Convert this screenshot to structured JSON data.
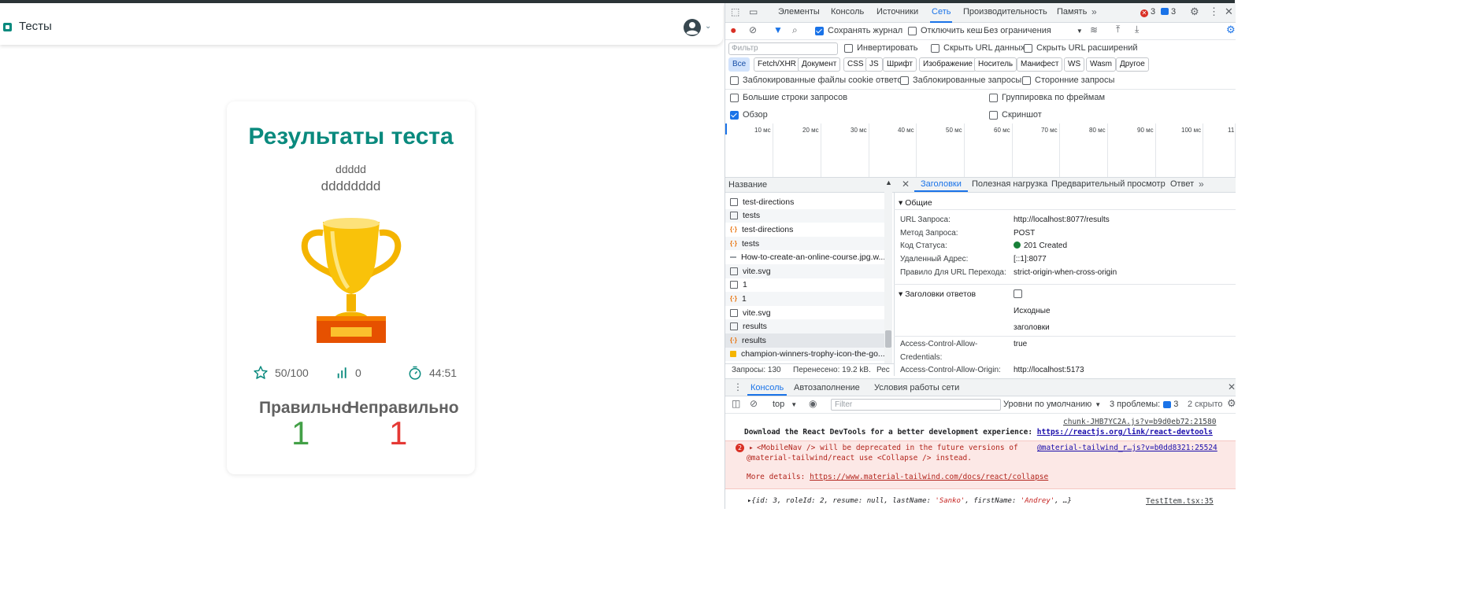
{
  "app": {
    "title": "Тесты",
    "card": {
      "title": "Результаты теста",
      "subtitle1": "ddddd",
      "subtitle2": "dddddddd",
      "stats": {
        "score": "50/100",
        "count": "0",
        "time": "44:51"
      },
      "labels": {
        "correct": "Правильно",
        "incorrect": "Неправильно"
      },
      "values": {
        "correct": "1",
        "incorrect": "1"
      }
    }
  },
  "devtools": {
    "tabs": [
      "Элементы",
      "Консоль",
      "Источники",
      "Сеть",
      "Производительность",
      "Память"
    ],
    "errors": "3",
    "messages": "3",
    "toolbar": {
      "preserve_log": "Сохранять журнал",
      "disable_cache": "Отключить кеш",
      "throttling": "Без ограничения"
    },
    "filter_placeholder": "Фильтр",
    "filter_options": {
      "invert": "Инвертировать",
      "hide_data": "Скрыть URL данных",
      "hide_ext": "Скрыть URL расширений"
    },
    "chips": [
      "Все",
      "Fetch/XHR",
      "Документ",
      "CSS",
      "JS",
      "Шрифт",
      "Изображение",
      "Носитель",
      "Манифест",
      "WS",
      "Wasm",
      "Другое"
    ],
    "checks": {
      "blocked_cookies": "Заблокированные файлы cookie ответов",
      "blocked_requests": "Заблокированные запросы",
      "third_party": "Сторонние запросы",
      "big_rows": "Большие строки запросов",
      "group_frames": "Группировка по фреймам",
      "overview": "Обзор",
      "screenshot": "Скриншот"
    },
    "timeline_ticks": [
      "10 мс",
      "20 мс",
      "30 мс",
      "40 мс",
      "50 мс",
      "60 мс",
      "70 мс",
      "80 мс",
      "90 мс",
      "100 мс",
      "11"
    ],
    "list_header": "Название",
    "requests": [
      {
        "name": "test-directions",
        "type": "doc"
      },
      {
        "name": "tests",
        "type": "doc"
      },
      {
        "name": "test-directions",
        "type": "xhr"
      },
      {
        "name": "tests",
        "type": "xhr"
      },
      {
        "name": "How-to-create-an-online-course.jpg.w...",
        "type": "img"
      },
      {
        "name": "vite.svg",
        "type": "doc"
      },
      {
        "name": "1",
        "type": "doc"
      },
      {
        "name": "1",
        "type": "xhr"
      },
      {
        "name": "vite.svg",
        "type": "doc"
      },
      {
        "name": "results",
        "type": "doc"
      },
      {
        "name": "results",
        "type": "xhr"
      },
      {
        "name": "champion-winners-trophy-icon-the-go...",
        "type": "trophy"
      }
    ],
    "footer": {
      "requests": "Запросы: 130",
      "transferred": "Перенесено: 19.2 kB.",
      "resources": "Рес"
    },
    "detail_tabs": [
      "Заголовки",
      "Полезная нагрузка",
      "Предварительный просмотр",
      "Ответ"
    ],
    "general_title": "Общие",
    "general": [
      {
        "k": "URL Запроса:",
        "v": "http://localhost:8077/results"
      },
      {
        "k": "Метод Запроса:",
        "v": "POST"
      },
      {
        "k": "Код Статуса:",
        "v": "201 Created"
      },
      {
        "k": "Удаленный Адрес:",
        "v": "[::1]:8077"
      },
      {
        "k": "Правило Для URL Перехода:",
        "v": "strict-origin-when-cross-origin"
      }
    ],
    "resp_title": "Заголовки ответов",
    "raw_1": "Исходные",
    "raw_2": "заголовки",
    "acac_k1": "Access-Control-Allow-",
    "acac_k2": "Credentials:",
    "acac_v": "true",
    "acao_k": "Access-Control-Allow-Origin:",
    "acao_v": "http://localhost:5173",
    "drawer_tabs": [
      "Консоль",
      "Автозаполнение",
      "Условия работы сети"
    ],
    "console_bar": {
      "context": "top",
      "filter": "Filter",
      "levels": "Уровни по умолчанию",
      "problems": "3 проблемы:",
      "problems_count": "3",
      "hidden": "2 скрыто"
    },
    "console": {
      "src1": "chunk-JHB7YC2A.js?v=b9d0eb72:21580",
      "msg1": "Download the React DevTools for a better development experience:",
      "link1": "https://reactjs.org/link/react-devtools",
      "warn_count": "2",
      "src2": "@material-tailwind_r…js?v=b0dd8321:25524",
      "warn1": "<MobileNav /> will be deprecated in the future versions of",
      "warn2": "@material-tailwind/react use <Collapse /> instead.",
      "more": "More details:",
      "link2": "https://www.material-tailwind.com/docs/react/collapse",
      "obj_prefix": "{id: 3, roleId: 2, resume: null, lastName: ",
      "obj_last": "'Sanko'",
      "obj_mid": ", firstName: ",
      "obj_first": "'Andrey'",
      "obj_end": ", …}",
      "src3": "TestItem.tsx:35"
    },
    "colors": {
      "accent": "#1a73e8",
      "teal": "#0a8a7e",
      "green": "#43a047",
      "red": "#e53935"
    }
  }
}
